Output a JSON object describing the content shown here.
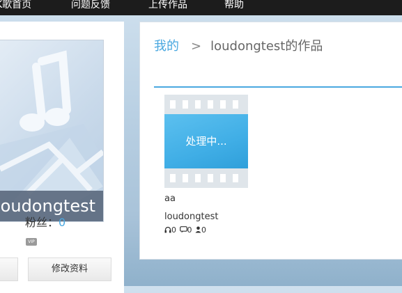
{
  "nav": {
    "items": [
      "K歌首页",
      "问题反馈",
      "上传作品",
      "帮助"
    ]
  },
  "profile": {
    "name": "loudongtest",
    "fans_label": "粉丝：",
    "fans_count": "0",
    "vip_label": "VIP",
    "edit_button": "修改资料",
    "cover_icon": "music-note-icon"
  },
  "breadcrumb": {
    "root": "我的",
    "separator": ">",
    "current": "loudongtest的作品"
  },
  "works": [
    {
      "status": "处理中...",
      "title": "aa",
      "author": "loudongtest",
      "listens": "0",
      "comments": "0",
      "gifts": "0"
    }
  ],
  "colors": {
    "accent": "#4aa8e0",
    "nav_bg": "#1c1c1c",
    "processing_bg": "#40aee6"
  }
}
